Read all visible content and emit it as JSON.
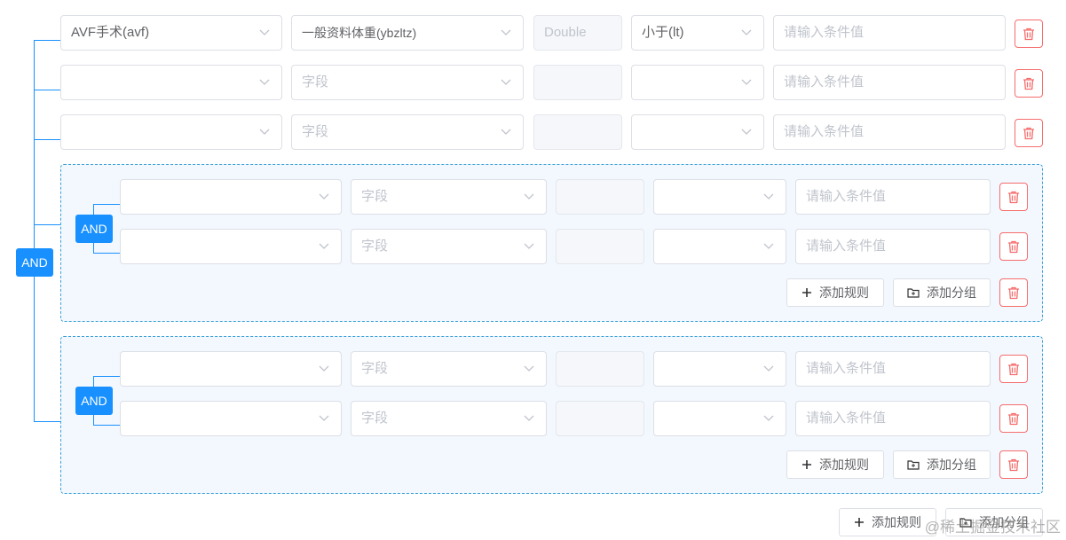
{
  "root": {
    "operator": "AND"
  },
  "rows": [
    {
      "field1": "AVF手术(avf)",
      "field2": "一般资料体重(ybzltz)",
      "type": "Double",
      "op": "小于(lt)",
      "value_placeholder": "请输入条件值"
    },
    {
      "field1": "",
      "field2_placeholder": "字段",
      "type": "",
      "op": "",
      "value_placeholder": "请输入条件值"
    },
    {
      "field1": "",
      "field2_placeholder": "字段",
      "type": "",
      "op": "",
      "value_placeholder": "请输入条件值"
    }
  ],
  "groups": [
    {
      "operator": "AND",
      "rows": [
        {
          "field2_placeholder": "字段",
          "value_placeholder": "请输入条件值"
        },
        {
          "field2_placeholder": "字段",
          "value_placeholder": "请输入条件值"
        }
      ],
      "add_rule_label": "添加规则",
      "add_group_label": "添加分组"
    },
    {
      "operator": "AND",
      "rows": [
        {
          "field2_placeholder": "字段",
          "value_placeholder": "请输入条件值"
        },
        {
          "field2_placeholder": "字段",
          "value_placeholder": "请输入条件值"
        }
      ],
      "add_rule_label": "添加规则",
      "add_group_label": "添加分组"
    }
  ],
  "footer": {
    "add_rule_label": "添加规则",
    "add_group_label": "添加分组"
  },
  "watermark": "@稀土掘金技术社区",
  "colors": {
    "primary": "#1890ff",
    "danger": "#f56c6c",
    "group_bg": "#f3f8fe",
    "group_border": "#3aa0d8"
  },
  "icons": {
    "delete": "trash-icon",
    "select": "chevron-down-icon",
    "add": "plus-icon",
    "group": "folder-icon"
  }
}
